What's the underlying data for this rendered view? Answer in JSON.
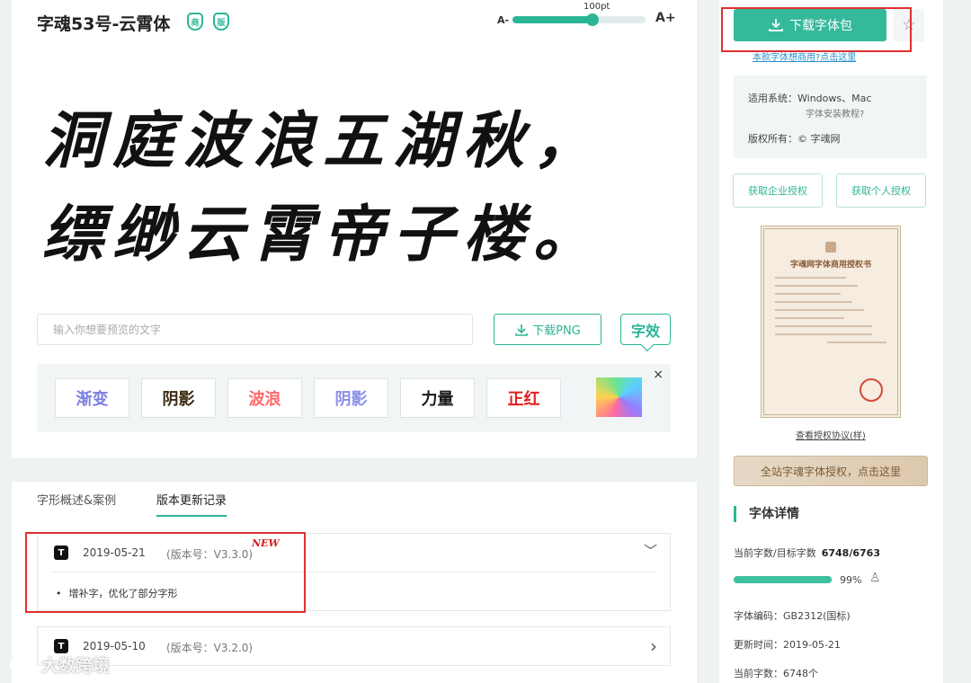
{
  "font": {
    "title": "字魂53号-云霄体",
    "badges": [
      "商",
      "版"
    ]
  },
  "size_control": {
    "minus_label": "A-",
    "plus_label": "A+",
    "value": "100pt",
    "level": 0.6
  },
  "preview": {
    "line1": "洞庭波浪五湖秋，",
    "line2": "缥缈云霄帝子楼。",
    "input_placeholder": "输入你想要预览的文字",
    "download_png_label": "下载PNG",
    "effect_toggle_label": "字效"
  },
  "effects": {
    "buttons": [
      {
        "label": "渐变",
        "color": "#7b7fe0"
      },
      {
        "label": "阴影",
        "color": "#3a2a10"
      },
      {
        "label": "波浪",
        "color": "#ff6a6a"
      },
      {
        "label": "阴影",
        "color": "#8a8fe6"
      },
      {
        "label": "力量",
        "color": "#1a1a1a"
      },
      {
        "label": "正红",
        "color": "#e02020"
      }
    ],
    "close_label": "×"
  },
  "tabs": [
    {
      "label": "字形概述&案例"
    },
    {
      "label": "版本更新记录"
    }
  ],
  "changelog": [
    {
      "icon": "T",
      "date": "2019-05-21",
      "version": "(版本号：V3.3.0)",
      "new": "NEW",
      "note": "增补字，优化了部分字形",
      "arrow": "﹀"
    },
    {
      "icon": "T",
      "date": "2019-05-10",
      "version": "(版本号：V3.2.0)",
      "arrow": "›"
    }
  ],
  "sidebar": {
    "download_label": "下载字体包",
    "commercial_link": "本款字体想商用?点击这里",
    "system": "适用系统：Windows、Mac",
    "tutorial": "字体安装教程?",
    "copyright": "版权所有：© 字魂网",
    "enterprise_auth": "获取企业授权",
    "personal_auth": "获取个人授权",
    "certificate_title": "字魂网字体商用授权书",
    "certificate_link": "查看授权协议(样)",
    "allsite_label": "全站字魂字体授权，点击这里",
    "detail_heading": "字体详情",
    "count_label": "当前字数/目标字数",
    "count_value": "6748/6763",
    "progress_pct": "99%",
    "progress": 0.99,
    "encoding": "字体编码：GB2312(国标)",
    "updated": "更新时间：2019-05-21",
    "current_count": "当前字数：6748个"
  },
  "watermark": "大数跨境",
  "colors": {
    "accent": "#2bb596",
    "highlight_box": "#e03030"
  }
}
